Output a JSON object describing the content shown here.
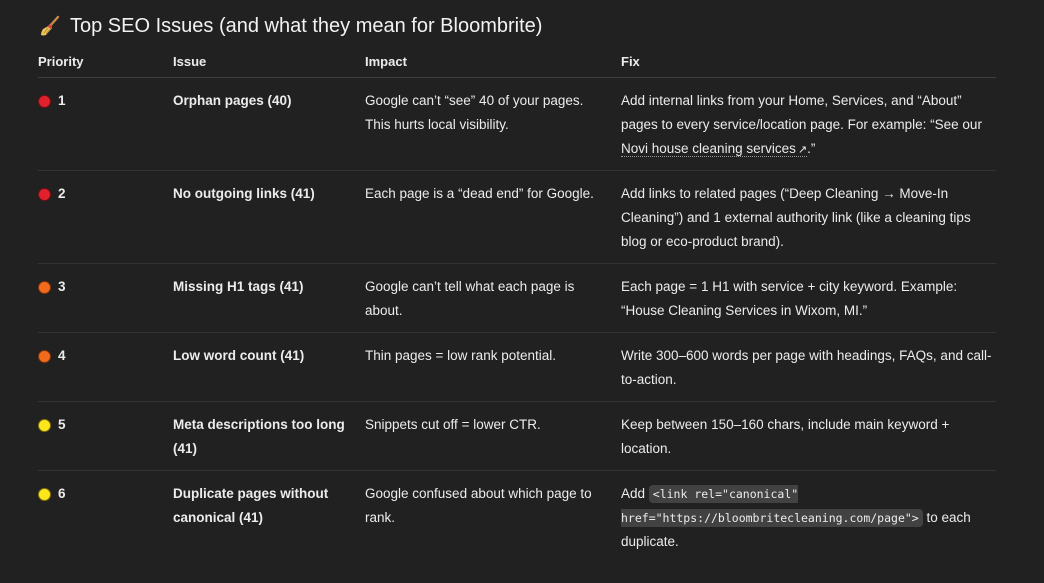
{
  "title": "Top SEO Issues (and what they mean for Bloombrite)",
  "headers": [
    "Priority",
    "Issue",
    "Impact",
    "Fix"
  ],
  "colors": {
    "red": "#e0212b",
    "orange": "#f26a1b",
    "yellow": "#ffe61b"
  },
  "rows": [
    {
      "priority": "1",
      "dot_color": "red",
      "issue": "Orphan pages (40)",
      "impact": "Google can’t “see” 40 of your pages. This hurts local visibility.",
      "fix_text": "Add internal links from your Home, Services, and “About” pages to every service/location page. For example: “See our ",
      "fix_link": "Novi house cleaning services",
      "fix_after": ".”"
    },
    {
      "priority": "2",
      "dot_color": "red",
      "issue": "No outgoing links (41)",
      "impact": "Each page is a “dead end” for Google.",
      "fix": "Add links to related pages (“Deep Cleaning → Move-In Cleaning”) and 1 external authority link (like a cleaning tips blog or eco-product brand)."
    },
    {
      "priority": "3",
      "dot_color": "orange",
      "issue": "Missing H1 tags (41)",
      "impact": "Google can’t tell what each page is about.",
      "fix": "Each page = 1 H1 with service + city keyword. Example: “House Cleaning Services in Wixom, MI.”"
    },
    {
      "priority": "4",
      "dot_color": "orange",
      "issue": "Low word count (41)",
      "impact": "Thin pages = low rank potential.",
      "fix": "Write 300–600 words per page with headings, FAQs, and call-to-action."
    },
    {
      "priority": "5",
      "dot_color": "yellow",
      "issue": "Meta descriptions too long (41)",
      "impact": "Snippets cut off = lower CTR.",
      "fix": "Keep between 150–160 chars, include main keyword + location."
    },
    {
      "priority": "6",
      "dot_color": "yellow",
      "issue": "Duplicate pages without canonical (41)",
      "impact": "Google confused about which page to rank.",
      "fix_before": "Add ",
      "fix_code": "<link rel=\"canonical\" href=\"https://bloombritecleaning.com/page\">",
      "fix_after": " to each duplicate."
    }
  ]
}
